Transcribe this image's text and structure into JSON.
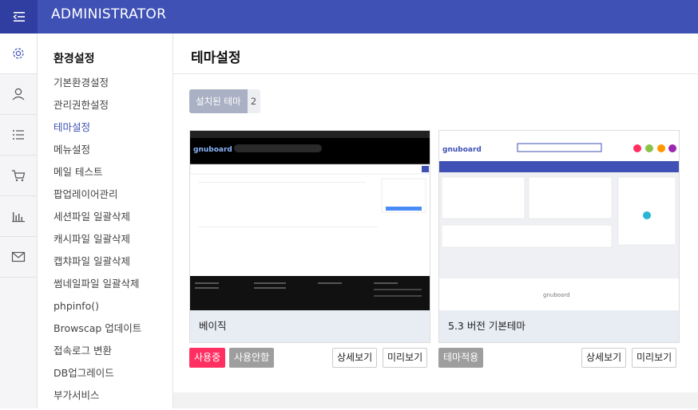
{
  "header": {
    "title": "ADMINISTRATOR"
  },
  "submenu": {
    "title": "환경설정",
    "items": [
      {
        "label": "기본환경설정"
      },
      {
        "label": "관리권한설정"
      },
      {
        "label": "테마설정"
      },
      {
        "label": "메뉴설정"
      },
      {
        "label": "메일 테스트"
      },
      {
        "label": "팝업레이어관리"
      },
      {
        "label": "세션파일 일괄삭제"
      },
      {
        "label": "캐시파일 일괄삭제"
      },
      {
        "label": "캡챠파일 일괄삭제"
      },
      {
        "label": "썸네일파일 일괄삭제"
      },
      {
        "label": "phpinfo()"
      },
      {
        "label": "Browscap 업데이트"
      },
      {
        "label": "접속로그 변환"
      },
      {
        "label": "DB업그레이드"
      },
      {
        "label": "부가서비스"
      }
    ],
    "current_index": 2
  },
  "main": {
    "title": "테마설정",
    "installed_label": "설치된 테마",
    "installed_count": "2"
  },
  "themes": [
    {
      "name": "베이직",
      "buttons": {
        "in_use": "사용중",
        "disable": "사용안함",
        "detail": "상세보기",
        "preview": "미리보기"
      },
      "thumb": {
        "logo": "gnuboard"
      }
    },
    {
      "name": "5.3 버전 기본테마",
      "buttons": {
        "apply": "테마적용",
        "detail": "상세보기",
        "preview": "미리보기"
      },
      "thumb": {
        "logo": "gnuboard"
      }
    }
  ],
  "colors": {
    "header": "#3f51b5",
    "accent": "#3f51b5",
    "in_use": "#ff3061"
  }
}
